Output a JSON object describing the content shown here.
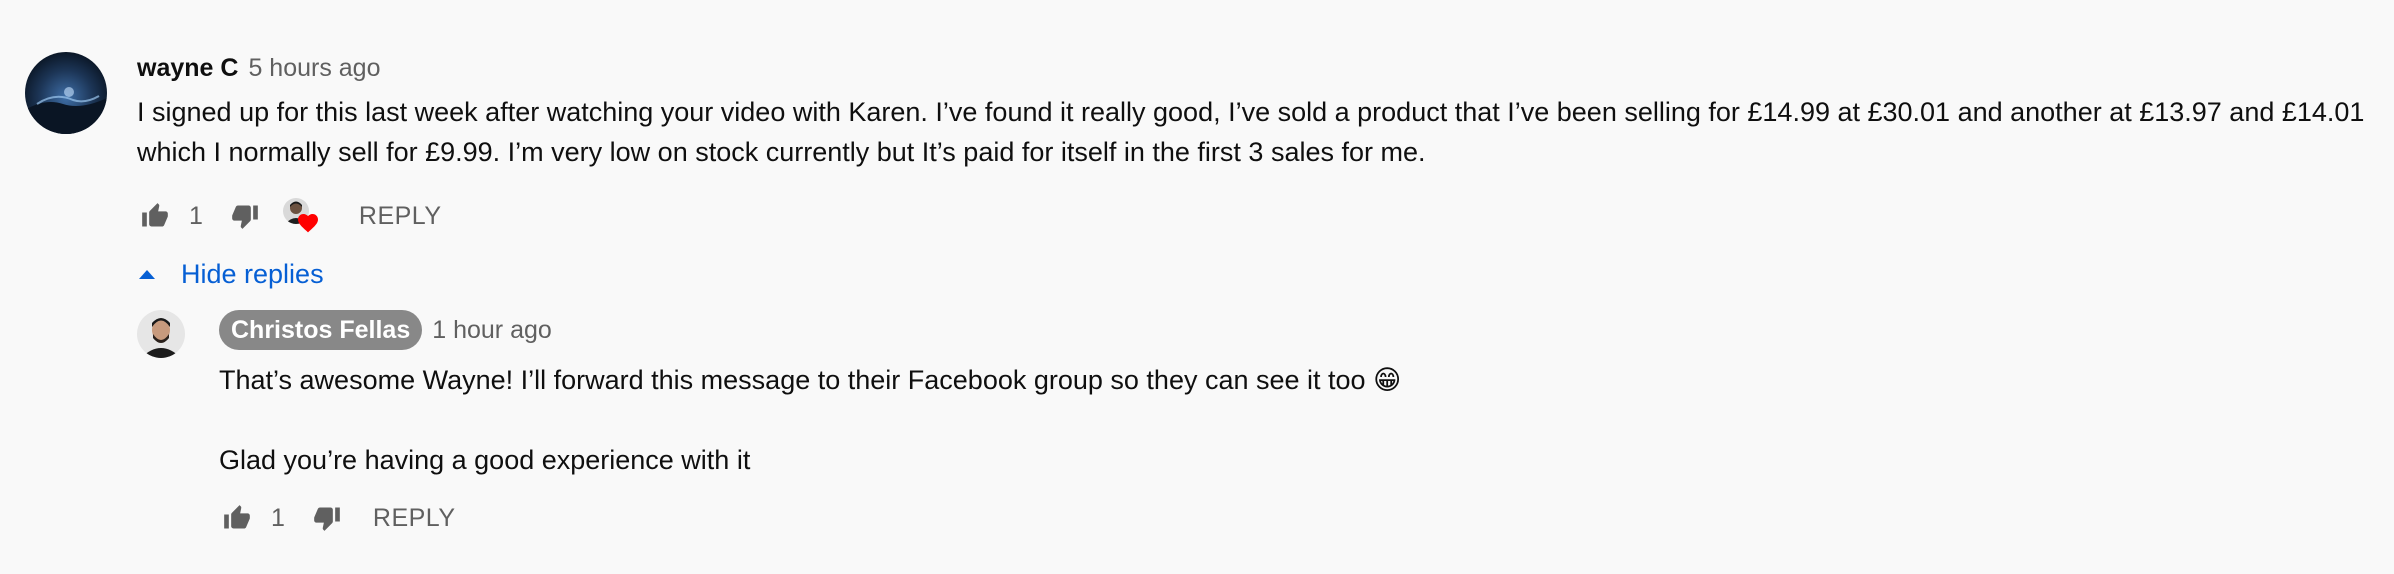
{
  "comment": {
    "author": "wayne C",
    "timestamp": "5 hours ago",
    "text": "I signed up for this last week after watching your video with Karen. I’ve found it really good, I’ve sold a product that I’ve been selling for £14.99 at £30.01 and another at £13.97 and £14.01 which I normally sell for £9.99. I’m very low on stock currently but It’s paid for itself in the first 3 sales for me.",
    "like_count": "1",
    "reply_label": "REPLY",
    "avatar_icon": "user-avatar-dark-blue",
    "hearted_by_creator": true
  },
  "toggle": {
    "hide_replies_label": "Hide replies",
    "icon": "caret-up-icon"
  },
  "reply": {
    "author": "Christos Fellas",
    "timestamp": "1 hour ago",
    "text_line1": "That’s awesome Wayne! I’ll forward this message to their Facebook group so they can see it too 😁",
    "text_line2": "Glad you’re having a good experience with it",
    "like_count": "1",
    "reply_label": "REPLY",
    "avatar_icon": "creator-avatar"
  },
  "colors": {
    "link_blue": "#065fd4",
    "secondary_text": "#606060",
    "badge_gray": "#888888",
    "heart_red": "#ff0000",
    "background": "#f9f9f9"
  }
}
